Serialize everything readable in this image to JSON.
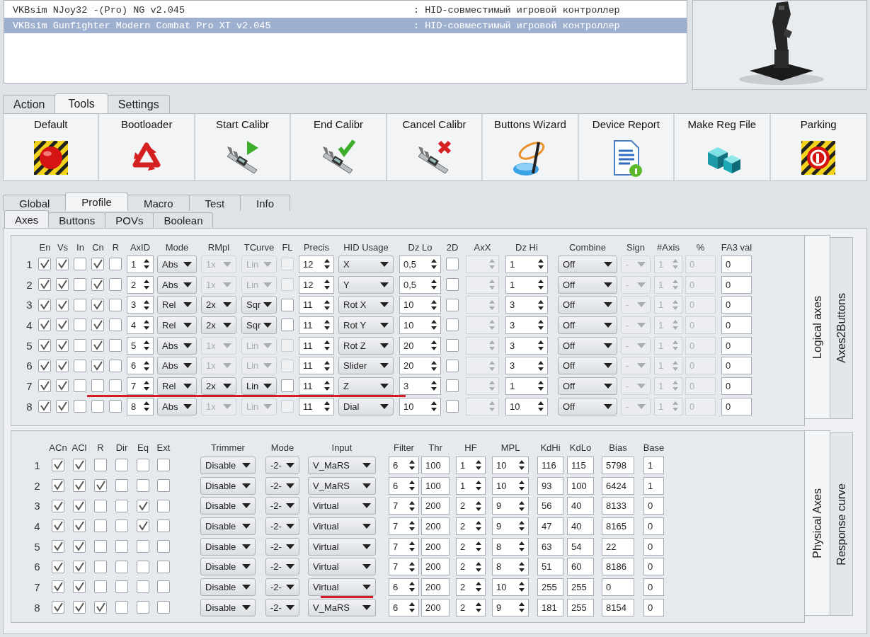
{
  "devices": [
    {
      "name": "VKBsim NJoy32 -(Pro) NG v2.045",
      "driver": ": HID-совместимый игровой контроллер",
      "selected": false
    },
    {
      "name": "VKBsim Gunfighter Modern Combat Pro XT v2.045",
      "driver": ": HID-совместимый игровой контроллер",
      "selected": true
    }
  ],
  "main_tabs": [
    {
      "label": "Action",
      "selected": false
    },
    {
      "label": "Tools",
      "selected": true
    },
    {
      "label": "Settings",
      "selected": false
    }
  ],
  "toolbar": [
    {
      "label": "Default",
      "kind": "hazard-button"
    },
    {
      "label": "Bootloader",
      "kind": "recycle"
    },
    {
      "label": "Start Calibr",
      "kind": "caliper-play"
    },
    {
      "label": "End Calibr",
      "kind": "caliper-check"
    },
    {
      "label": "Cancel Calibr",
      "kind": "caliper-cross"
    },
    {
      "label": "Buttons Wizard",
      "kind": "wizard"
    },
    {
      "label": "Device Report",
      "kind": "document"
    },
    {
      "label": "Make Reg File",
      "kind": "cubes"
    },
    {
      "label": "Parking",
      "kind": "parking"
    }
  ],
  "section_tabs": [
    {
      "label": "Global",
      "selected": false
    },
    {
      "label": "Profile",
      "selected": true
    },
    {
      "label": "Macro",
      "selected": false
    },
    {
      "label": "Test",
      "selected": false
    },
    {
      "label": "Info",
      "selected": false
    }
  ],
  "profile_tabs": [
    {
      "label": "Axes",
      "selected": true
    },
    {
      "label": "Buttons",
      "selected": false
    },
    {
      "label": "POVs",
      "selected": false
    },
    {
      "label": "Boolean",
      "selected": false
    }
  ],
  "logical": {
    "headers": [
      "En",
      "Vs",
      "In",
      "Cn",
      "R",
      "AxID",
      "Mode",
      "RMpl",
      "TCurve",
      "FL",
      "Precis",
      "HID Usage",
      "Dz Lo",
      "2D",
      "AxX",
      "Dz Hi",
      "Combine",
      "Sign",
      "#Axis",
      "%",
      "FA3 val"
    ],
    "rows": [
      {
        "number": "1",
        "checks": [
          true,
          true,
          false,
          true,
          false
        ],
        "axis_id": "1",
        "mode": "Abs",
        "multiplier": "1x",
        "curve": "Lin",
        "fl": false,
        "curve_disabled": true,
        "precision": "12",
        "hid_usage": "X",
        "deadzone_low": "0,5",
        "two_d": false,
        "deadzone_high": "1",
        "combine": "Off",
        "sign": "-",
        "axis_count": "1",
        "percent": "0",
        "combine_disabled": true,
        "fa3": "0",
        "underlined": false
      },
      {
        "number": "2",
        "checks": [
          true,
          true,
          false,
          true,
          false
        ],
        "axis_id": "2",
        "mode": "Abs",
        "multiplier": "1x",
        "curve": "Lin",
        "fl": false,
        "curve_disabled": true,
        "precision": "12",
        "hid_usage": "Y",
        "deadzone_low": "0,5",
        "two_d": false,
        "deadzone_high": "1",
        "combine": "Off",
        "sign": "-",
        "axis_count": "1",
        "percent": "0",
        "combine_disabled": true,
        "fa3": "0",
        "underlined": false
      },
      {
        "number": "3",
        "checks": [
          true,
          true,
          false,
          true,
          false
        ],
        "axis_id": "3",
        "mode": "Rel",
        "multiplier": "2x",
        "curve": "Sqr",
        "fl": false,
        "curve_disabled": false,
        "precision": "11",
        "hid_usage": "Rot X",
        "deadzone_low": "10",
        "two_d": false,
        "deadzone_high": "3",
        "combine": "Off",
        "sign": "-",
        "axis_count": "1",
        "percent": "0",
        "combine_disabled": true,
        "fa3": "0",
        "underlined": false
      },
      {
        "number": "4",
        "checks": [
          true,
          true,
          false,
          true,
          false
        ],
        "axis_id": "4",
        "mode": "Rel",
        "multiplier": "2x",
        "curve": "Sqr",
        "fl": false,
        "curve_disabled": false,
        "precision": "11",
        "hid_usage": "Rot Y",
        "deadzone_low": "10",
        "two_d": false,
        "deadzone_high": "3",
        "combine": "Off",
        "sign": "-",
        "axis_count": "1",
        "percent": "0",
        "combine_disabled": true,
        "fa3": "0",
        "underlined": false
      },
      {
        "number": "5",
        "checks": [
          true,
          true,
          false,
          true,
          false
        ],
        "axis_id": "5",
        "mode": "Abs",
        "multiplier": "1x",
        "curve": "Lin",
        "fl": false,
        "curve_disabled": true,
        "precision": "11",
        "hid_usage": "Rot Z",
        "deadzone_low": "20",
        "two_d": false,
        "deadzone_high": "3",
        "combine": "Off",
        "sign": "-",
        "axis_count": "1",
        "percent": "0",
        "combine_disabled": true,
        "fa3": "0",
        "underlined": false
      },
      {
        "number": "6",
        "checks": [
          true,
          true,
          false,
          true,
          false
        ],
        "axis_id": "6",
        "mode": "Abs",
        "multiplier": "1x",
        "curve": "Lin",
        "fl": false,
        "curve_disabled": true,
        "precision": "11",
        "hid_usage": "Slider",
        "deadzone_low": "20",
        "two_d": false,
        "deadzone_high": "3",
        "combine": "Off",
        "sign": "-",
        "axis_count": "1",
        "percent": "0",
        "combine_disabled": true,
        "fa3": "0",
        "underlined": false
      },
      {
        "number": "7",
        "checks": [
          true,
          true,
          false,
          false,
          false
        ],
        "axis_id": "7",
        "mode": "Rel",
        "multiplier": "2x",
        "curve": "Lin",
        "fl": false,
        "curve_disabled": false,
        "precision": "11",
        "hid_usage": "Z",
        "deadzone_low": "3",
        "two_d": false,
        "deadzone_high": "1",
        "combine": "Off",
        "sign": "-",
        "axis_count": "1",
        "percent": "0",
        "combine_disabled": true,
        "fa3": "0",
        "underlined": true
      },
      {
        "number": "8",
        "checks": [
          true,
          true,
          false,
          false,
          false
        ],
        "axis_id": "8",
        "mode": "Abs",
        "multiplier": "1x",
        "curve": "Lin",
        "fl": false,
        "curve_disabled": true,
        "precision": "11",
        "hid_usage": "Dial",
        "deadzone_low": "10",
        "two_d": false,
        "deadzone_high": "10",
        "combine": "Off",
        "sign": "-",
        "axis_count": "1",
        "percent": "0",
        "combine_disabled": true,
        "fa3": "0",
        "underlined": false
      }
    ],
    "side_tabs": [
      {
        "label": "Logical axes",
        "selected": true
      },
      {
        "label": "Axes2Buttons",
        "selected": false
      }
    ]
  },
  "physical": {
    "headers": [
      "ACn",
      "ACl",
      "R",
      "Dir",
      "Eq",
      "Ext",
      "Trimmer",
      "Mode",
      "Input",
      "Filter",
      "Thr",
      "HF",
      "MPL",
      "KdHi",
      "KdLo",
      "Bias",
      "Base"
    ],
    "rows": [
      {
        "number": "1",
        "checks": [
          true,
          true,
          false,
          false,
          false,
          false
        ],
        "trimmer": "Disable",
        "mode": "-2-",
        "input": "V_MaRS",
        "filter": "6",
        "threshold": "100",
        "hf": "1",
        "mpl": "10",
        "kd_high": "116",
        "kd_low": "115",
        "bias": "5798",
        "base": "1",
        "underlined": false
      },
      {
        "number": "2",
        "checks": [
          true,
          true,
          true,
          false,
          false,
          false
        ],
        "trimmer": "Disable",
        "mode": "-2-",
        "input": "V_MaRS",
        "filter": "6",
        "threshold": "100",
        "hf": "1",
        "mpl": "10",
        "kd_high": "93",
        "kd_low": "100",
        "bias": "6424",
        "base": "1",
        "underlined": false
      },
      {
        "number": "3",
        "checks": [
          true,
          true,
          false,
          false,
          true,
          false
        ],
        "trimmer": "Disable",
        "mode": "-2-",
        "input": "Virtual",
        "filter": "7",
        "threshold": "200",
        "hf": "2",
        "mpl": "9",
        "kd_high": "56",
        "kd_low": "40",
        "bias": "8133",
        "base": "0",
        "underlined": false
      },
      {
        "number": "4",
        "checks": [
          true,
          true,
          false,
          false,
          true,
          false
        ],
        "trimmer": "Disable",
        "mode": "-2-",
        "input": "Virtual",
        "filter": "7",
        "threshold": "200",
        "hf": "2",
        "mpl": "9",
        "kd_high": "47",
        "kd_low": "40",
        "bias": "8165",
        "base": "0",
        "underlined": false
      },
      {
        "number": "5",
        "checks": [
          true,
          true,
          false,
          false,
          false,
          false
        ],
        "trimmer": "Disable",
        "mode": "-2-",
        "input": "Virtual",
        "filter": "7",
        "threshold": "200",
        "hf": "2",
        "mpl": "8",
        "kd_high": "63",
        "kd_low": "54",
        "bias": "22",
        "base": "0",
        "underlined": false
      },
      {
        "number": "6",
        "checks": [
          true,
          true,
          false,
          false,
          false,
          false
        ],
        "trimmer": "Disable",
        "mode": "-2-",
        "input": "Virtual",
        "filter": "7",
        "threshold": "200",
        "hf": "2",
        "mpl": "8",
        "kd_high": "51",
        "kd_low": "60",
        "bias": "8186",
        "base": "0",
        "underlined": false
      },
      {
        "number": "7",
        "checks": [
          true,
          true,
          false,
          false,
          false,
          false
        ],
        "trimmer": "Disable",
        "mode": "-2-",
        "input": "Virtual",
        "filter": "6",
        "threshold": "200",
        "hf": "2",
        "mpl": "10",
        "kd_high": "255",
        "kd_low": "255",
        "bias": "0",
        "base": "0",
        "underlined": true
      },
      {
        "number": "8",
        "checks": [
          true,
          true,
          true,
          false,
          false,
          false
        ],
        "trimmer": "Disable",
        "mode": "-2-",
        "input": "V_MaRS",
        "filter": "6",
        "threshold": "200",
        "hf": "2",
        "mpl": "9",
        "kd_high": "181",
        "kd_low": "255",
        "bias": "8154",
        "base": "0",
        "underlined": false
      }
    ],
    "side_tabs": [
      {
        "label": "Physical Axes",
        "selected": true
      },
      {
        "label": "Response curve",
        "selected": false
      }
    ]
  }
}
